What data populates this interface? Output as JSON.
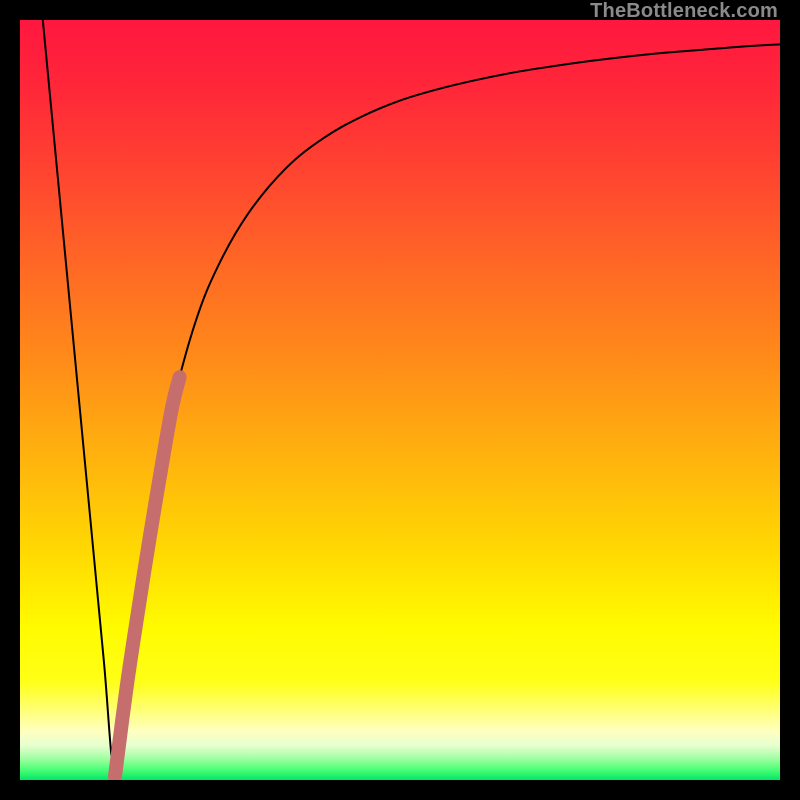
{
  "watermark": "TheBottleneck.com",
  "colors": {
    "frame": "#000000",
    "gradient_stops": [
      {
        "offset": 0.0,
        "color": "#ff173f"
      },
      {
        "offset": 0.09,
        "color": "#ff2739"
      },
      {
        "offset": 0.2,
        "color": "#ff4430"
      },
      {
        "offset": 0.33,
        "color": "#ff6a24"
      },
      {
        "offset": 0.46,
        "color": "#ff8f18"
      },
      {
        "offset": 0.58,
        "color": "#ffb40d"
      },
      {
        "offset": 0.7,
        "color": "#ffd902"
      },
      {
        "offset": 0.8,
        "color": "#fffb00"
      },
      {
        "offset": 0.87,
        "color": "#ffff17"
      },
      {
        "offset": 0.905,
        "color": "#ffff6e"
      },
      {
        "offset": 0.935,
        "color": "#ffffbf"
      },
      {
        "offset": 0.955,
        "color": "#e6ffcf"
      },
      {
        "offset": 0.972,
        "color": "#9effa0"
      },
      {
        "offset": 0.986,
        "color": "#4dff78"
      },
      {
        "offset": 1.0,
        "color": "#00e765"
      }
    ],
    "curve_main": "#000000",
    "curve_highlight": "#c66d6d"
  },
  "chart_data": {
    "type": "line",
    "title": "",
    "xlabel": "",
    "ylabel": "",
    "xlim": [
      0,
      100
    ],
    "ylim": [
      0,
      100
    ],
    "series": [
      {
        "name": "bottleneck-curve",
        "x": [
          3,
          5,
          7,
          9,
          11,
          12.5,
          14,
          16,
          18,
          20,
          23,
          26,
          30,
          35,
          40,
          45,
          50,
          55,
          60,
          65,
          70,
          75,
          80,
          85,
          90,
          95,
          100
        ],
        "y": [
          100,
          79,
          58,
          37,
          16,
          0.5,
          12,
          26,
          39,
          49,
          60,
          67.5,
          74.5,
          80.5,
          84.5,
          87.3,
          89.4,
          90.9,
          92.1,
          93.1,
          93.9,
          94.6,
          95.2,
          95.7,
          96.1,
          96.5,
          96.8
        ]
      },
      {
        "name": "highlight-segment",
        "x": [
          12.5,
          14.0,
          15.5,
          17.0,
          18.5,
          20.0,
          21.0
        ],
        "y": [
          0.5,
          12.0,
          22.0,
          31.5,
          40.5,
          49.0,
          53.0
        ]
      }
    ]
  }
}
